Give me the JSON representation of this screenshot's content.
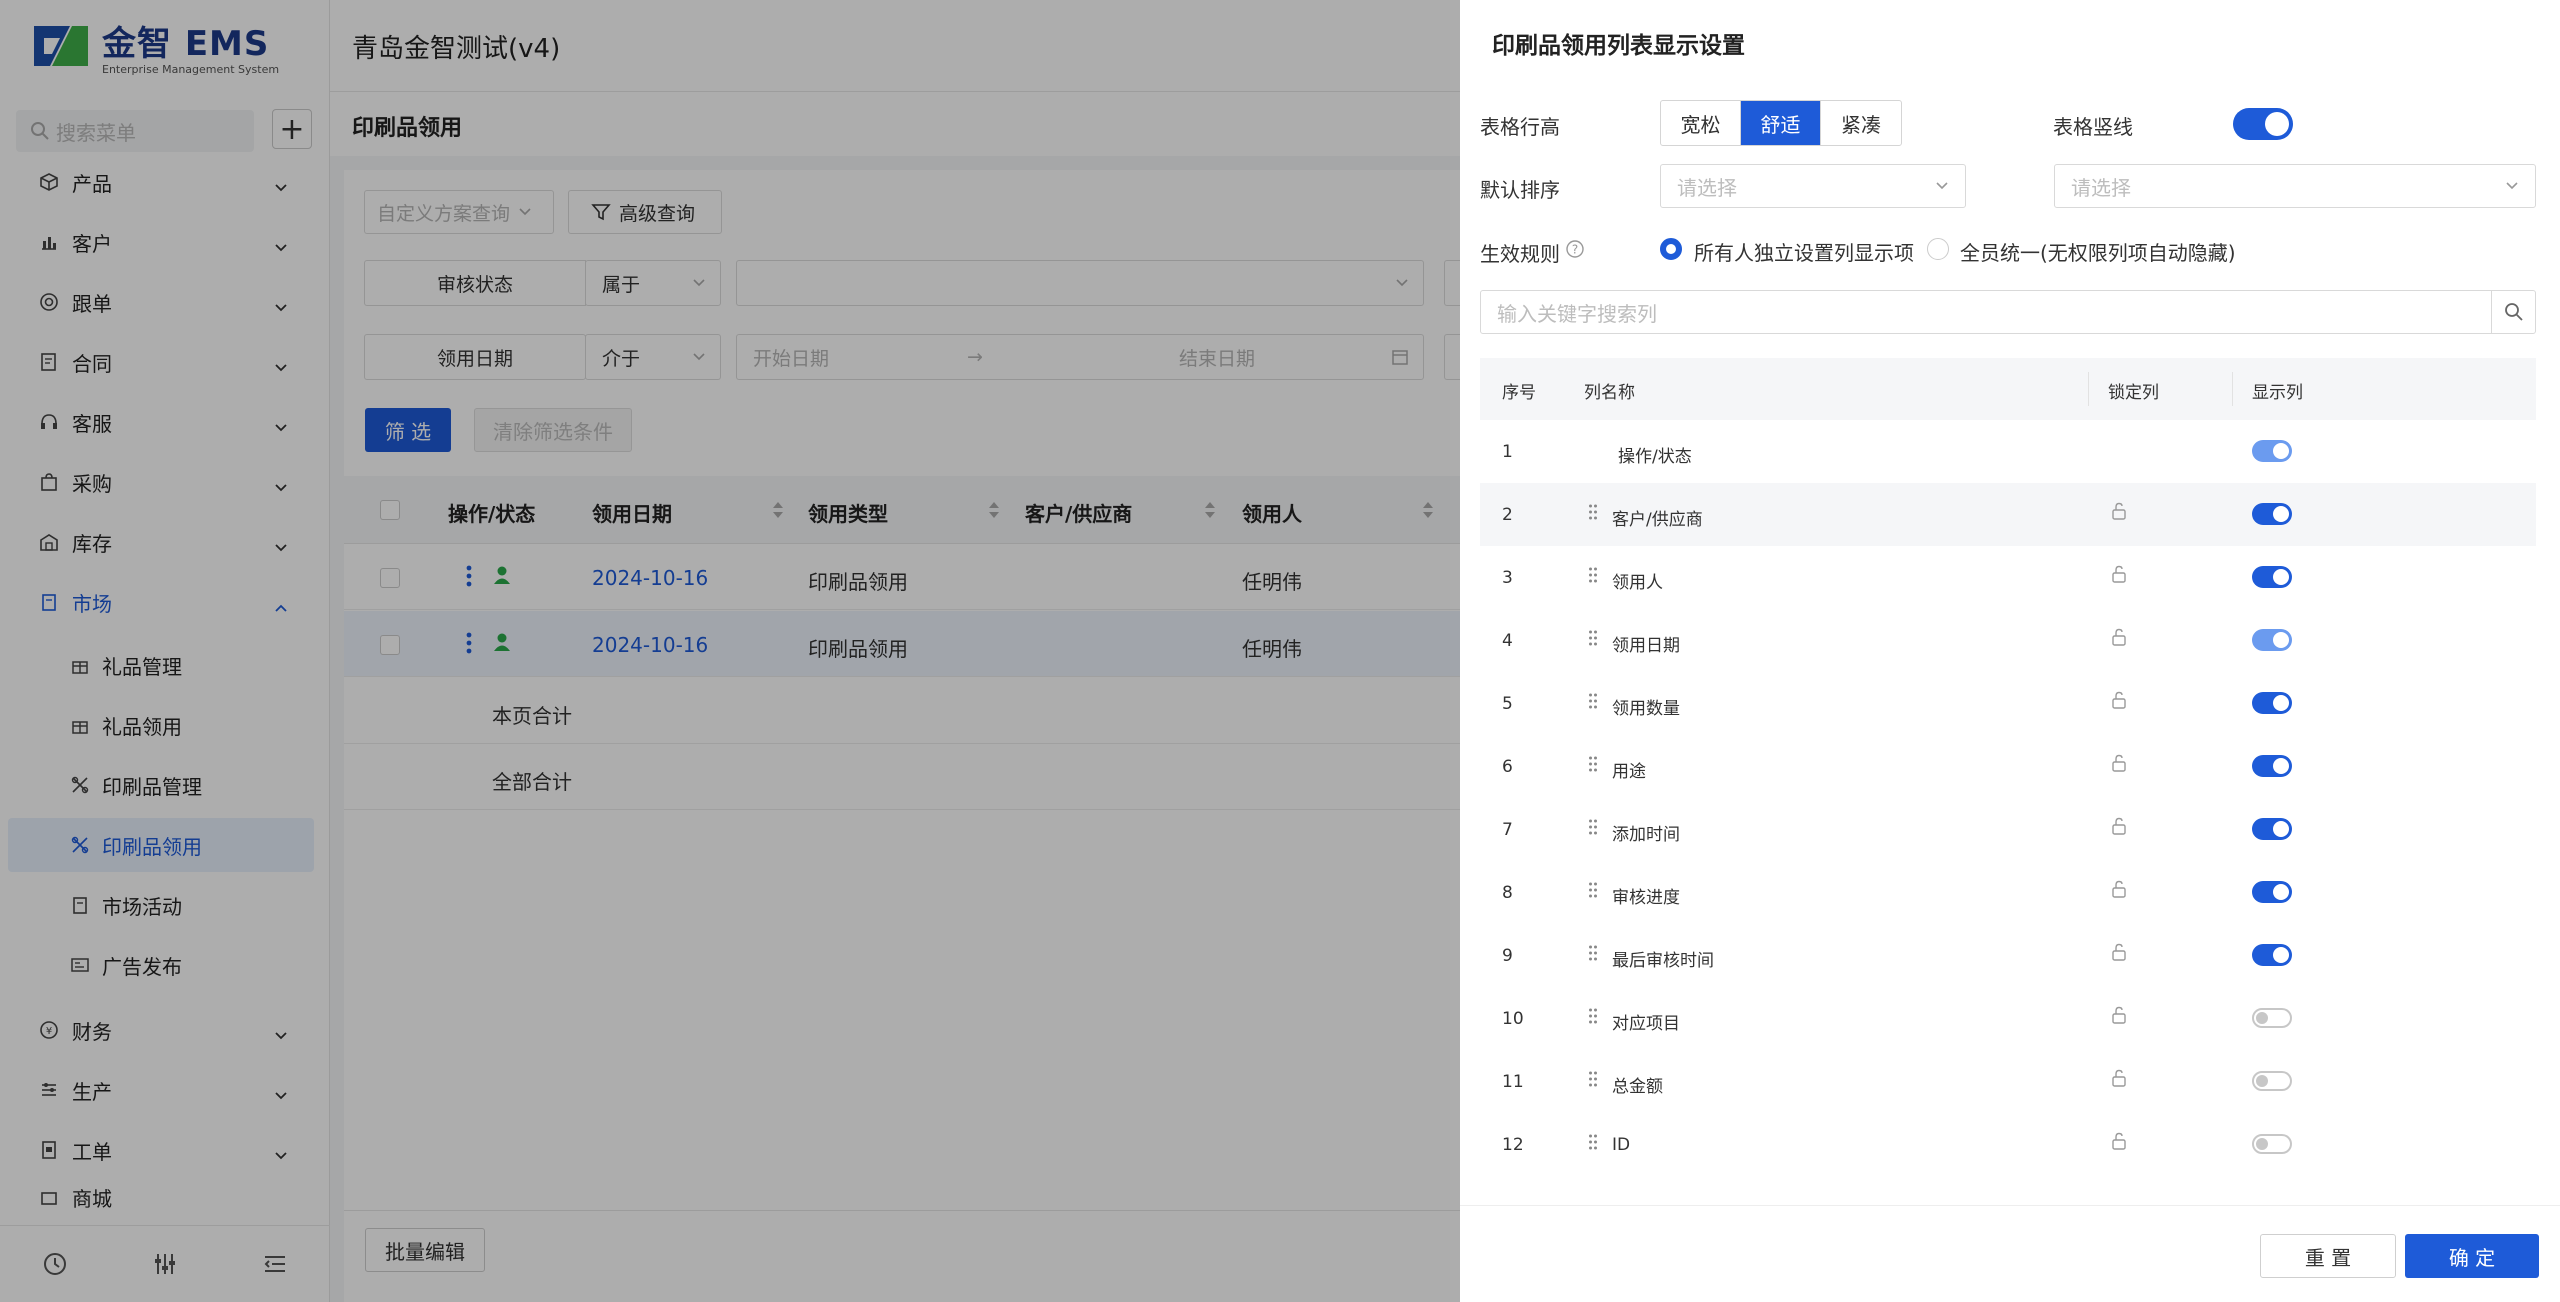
{
  "app": {
    "logo_name": "金智 EMS",
    "logo_sub": "Enterprise Management System",
    "company": "青岛金智测试(v4)"
  },
  "sidebar": {
    "search_placeholder": "搜索菜单",
    "items": [
      {
        "label": "产品",
        "icon": "cube-icon"
      },
      {
        "label": "客户",
        "icon": "chart-icon"
      },
      {
        "label": "跟单",
        "icon": "target-icon"
      },
      {
        "label": "合同",
        "icon": "contract-icon"
      },
      {
        "label": "客服",
        "icon": "headset-icon"
      },
      {
        "label": "采购",
        "icon": "bag-icon"
      },
      {
        "label": "库存",
        "icon": "warehouse-icon"
      },
      {
        "label": "市场",
        "icon": "flag-icon"
      },
      {
        "label": "财务",
        "icon": "coin-icon"
      },
      {
        "label": "生产",
        "icon": "factory-icon"
      },
      {
        "label": "工单",
        "icon": "ticket-icon"
      },
      {
        "label": "商城",
        "icon": "shop-icon"
      }
    ],
    "sub_items": [
      {
        "label": "礼品管理",
        "icon": "gift-icon"
      },
      {
        "label": "礼品领用",
        "icon": "gift-icon"
      },
      {
        "label": "印刷品管理",
        "icon": "print-icon"
      },
      {
        "label": "印刷品领用",
        "icon": "print-icon"
      },
      {
        "label": "市场活动",
        "icon": "flag-icon"
      },
      {
        "label": "广告发布",
        "icon": "ad-icon"
      }
    ]
  },
  "page": {
    "title": "印刷品领用"
  },
  "filters": {
    "scheme_placeholder": "自定义方案查询",
    "advanced_query": "高级查询",
    "f1_field": "审核状态",
    "f1_op": "属于",
    "f2_field": "领用日期",
    "f2_op": "介于",
    "start_date": "开始日期",
    "end_date": "结束日期",
    "arrow": "→",
    "filter_btn": "筛 选",
    "clear_btn": "清除筛选条件"
  },
  "table": {
    "headers": [
      "操作/状态",
      "领用日期",
      "领用类型",
      "客户/供应商",
      "领用人"
    ],
    "rows": [
      {
        "date": "2024-10-16",
        "type": "印刷品领用",
        "person": "任明伟"
      },
      {
        "date": "2024-10-16",
        "type": "印刷品领用",
        "person": "任明伟"
      }
    ],
    "page_total": "本页合计",
    "all_total": "全部合计",
    "batch_edit": "批量编辑"
  },
  "drawer": {
    "title": "印刷品领用列表显示设置",
    "row_height_label": "表格行高",
    "row_height_options": [
      "宽松",
      "舒适",
      "紧凑"
    ],
    "row_height_selected": "舒适",
    "vline_label": "表格竖线",
    "vline_on": true,
    "sort_label": "默认排序",
    "sort_placeholder1": "请选择",
    "sort_placeholder2": "请选择",
    "rule_label": "生效规则",
    "rule_opt1": "所有人独立设置列显示项",
    "rule_opt2": "全员统一(无权限列项自动隐藏)",
    "search_placeholder": "输入关键字搜索列",
    "col_headers": {
      "no": "序号",
      "name": "列名称",
      "lock": "锁定列",
      "show": "显示列"
    },
    "columns": [
      {
        "no": "1",
        "name": "操作/状态",
        "show": true,
        "fixed": true
      },
      {
        "no": "2",
        "name": "客户/供应商",
        "show": true
      },
      {
        "no": "3",
        "name": "领用人",
        "show": true
      },
      {
        "no": "4",
        "name": "领用日期",
        "show": true,
        "fixed": true
      },
      {
        "no": "5",
        "name": "领用数量",
        "show": true
      },
      {
        "no": "6",
        "name": "用途",
        "show": true
      },
      {
        "no": "7",
        "name": "添加时间",
        "show": true
      },
      {
        "no": "8",
        "name": "审核进度",
        "show": true
      },
      {
        "no": "9",
        "name": "最后审核时间",
        "show": true
      },
      {
        "no": "10",
        "name": "对应项目",
        "show": false
      },
      {
        "no": "11",
        "name": "总金额",
        "show": false
      },
      {
        "no": "12",
        "name": "ID",
        "show": false
      }
    ],
    "reset_btn": "重 置",
    "confirm_btn": "确 定"
  },
  "colors": {
    "primary": "#1e5bd8",
    "primary_light": "#6b9bef",
    "toggle_off": "#c7c7c7"
  }
}
